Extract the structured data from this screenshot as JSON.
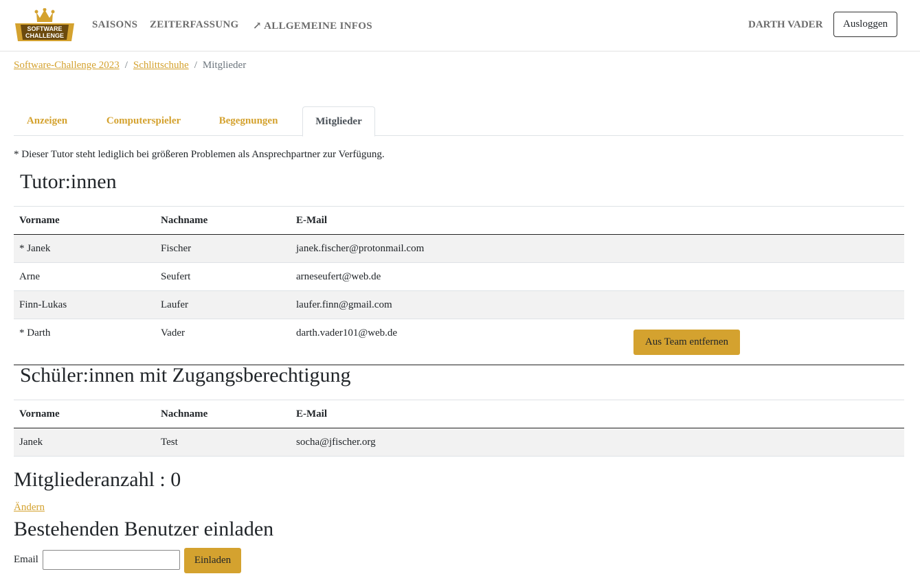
{
  "nav": {
    "logo_text_1": "SOFTWARE",
    "logo_text_2": "CHALLENGE",
    "links": [
      "SAISONS",
      "ZEITERFASSUNG",
      "ALLGEMEINE INFOS"
    ],
    "external_icon": "external-link-icon",
    "user": "DARTH VADER",
    "logout": "Ausloggen"
  },
  "breadcrumb": [
    "Software-Challenge 2023",
    "Schlittschuhe",
    "Mitglieder"
  ],
  "tabs": [
    "Anzeigen",
    "Computerspieler",
    "Begegnungen",
    "Mitglieder"
  ],
  "note": "* Dieser Tutor steht lediglich bei größeren Problemen als Ansprechpartner zur Verfügung.",
  "tutors": {
    "title": "Tutor:innen",
    "headers": [
      "Vorname",
      "Nachname",
      "E-Mail"
    ],
    "rows": [
      [
        "* Janek",
        "Fischer",
        "janek.fischer@protonmail.com"
      ],
      [
        "Arne",
        "Seufert",
        "arneseufert@web.de"
      ],
      [
        "Finn-Lukas",
        "Laufer",
        "laufer.finn@gmail.com"
      ],
      [
        "* Darth",
        "Vader",
        "darth.vader101@web.de"
      ]
    ],
    "remove_label": "Aus Team entfernen"
  },
  "students": {
    "title": "Schüler:innen mit Zugangsberechtigung",
    "headers": [
      "Vorname",
      "Nachname",
      "E-Mail"
    ],
    "rows": [
      [
        "Janek",
        "Test",
        "socha@jfischer.org"
      ]
    ]
  },
  "member_count": "Mitgliederanzahl : 0",
  "change_link": "Ändern",
  "invite": {
    "title": "Bestehenden Benutzer einladen",
    "email_label": "Email",
    "email_value": "",
    "button": "Einladen"
  },
  "colors": {
    "accent": "#d4a22f",
    "stripe": "#f2f2f2"
  }
}
